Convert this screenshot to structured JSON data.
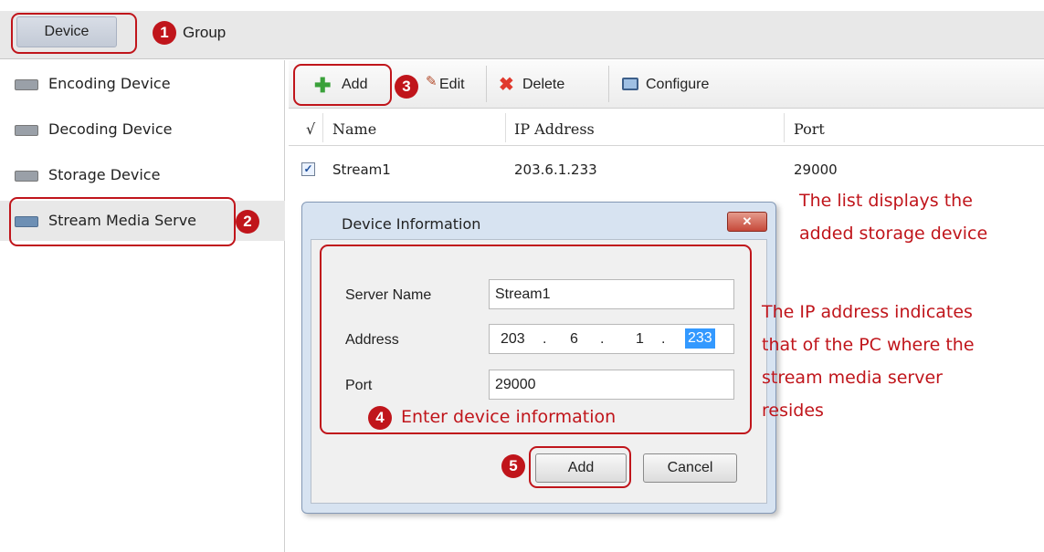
{
  "tabs": {
    "device": "Device",
    "group": "Group"
  },
  "sidebar": {
    "items": [
      {
        "label": "Encoding Device",
        "icon": "encoder-icon"
      },
      {
        "label": "Decoding Device",
        "icon": "decoder-icon"
      },
      {
        "label": "Storage Device",
        "icon": "storage-icon"
      },
      {
        "label": "Stream Media Serve",
        "icon": "stream-server-icon"
      }
    ]
  },
  "toolbar": {
    "add": "Add",
    "edit": "Edit",
    "delete": "Delete",
    "configure": "Configure"
  },
  "grid": {
    "columns": [
      "√",
      "Name",
      "IP Address",
      "Port"
    ],
    "rows": [
      {
        "name": "Stream1",
        "ip": "203.6.1.233",
        "port": "29000",
        "checked": true
      }
    ]
  },
  "dialog": {
    "title": "Device Information",
    "server_name_label": "Server Name",
    "server_name_value": "Stream1",
    "address_label": "Address",
    "ip_octets": [
      "203",
      "6",
      "1",
      "233"
    ],
    "port_label": "Port",
    "port_value": "29000",
    "add_button": "Add",
    "cancel_button": "Cancel"
  },
  "annotations": {
    "steps": [
      "1",
      "2",
      "3",
      "4",
      "5"
    ],
    "step4_text": "Enter device information",
    "note_list": [
      "The list displays the",
      "added storage device"
    ],
    "note_ip": [
      "The IP address indicates",
      "that of the PC where the",
      "stream media server",
      "resides"
    ]
  },
  "colors": {
    "annotation_red": "#c0151b",
    "dialog_blue": "#d7e3f1"
  }
}
